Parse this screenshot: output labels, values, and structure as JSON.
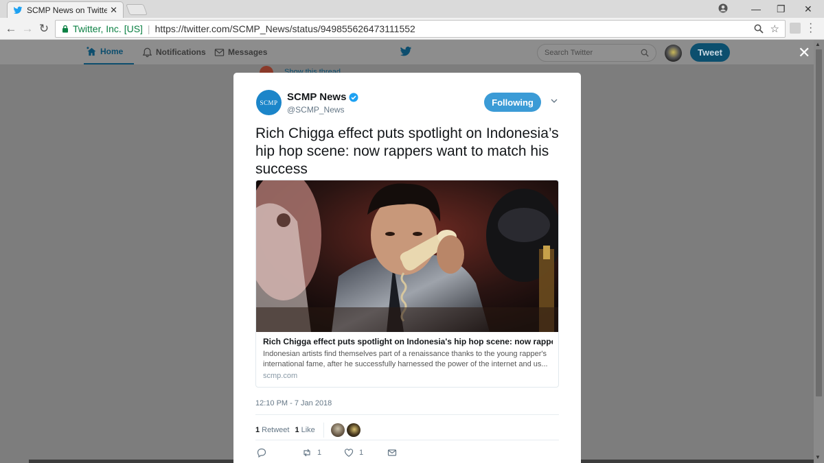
{
  "browser": {
    "tab_title": "SCMP News on Twitter: \"",
    "tab_close": "✕",
    "secure_label": "Twitter, Inc. [US]",
    "url": "https://twitter.com/SCMP_News/status/949855626473111552"
  },
  "twitter_header": {
    "nav": [
      {
        "label": "Home",
        "icon": "home-icon",
        "active": true
      },
      {
        "label": "Notifications",
        "icon": "bell-icon",
        "active": false
      },
      {
        "label": "Messages",
        "icon": "envelope-icon",
        "active": false
      }
    ],
    "search_placeholder": "Search Twitter",
    "tweet_button": "Tweet",
    "background_text": "Show this thread"
  },
  "tweet": {
    "author_name": "SCMP News",
    "author_handle": "@SCMP_News",
    "avatar_text": "SCMP",
    "follow_label": "Following",
    "text": "Rich Chigga effect puts spotlight on Indonesia’s hip hop scene: now rappers want to match his success",
    "card": {
      "title": "Rich Chigga effect puts spotlight on Indonesia's hip hop scene: now rappers ...",
      "description": "Indonesian artists find themselves part of a renaissance thanks to the young rapper's international fame, after he successfully harnessed the power of the internet and us...",
      "domain": "scmp.com"
    },
    "timestamp": "12:10 PM - 7 Jan 2018",
    "stats": {
      "retweets_count": "1",
      "retweets_label": "Retweet",
      "likes_count": "1",
      "likes_label": "Like"
    },
    "actions": {
      "reply_count": "",
      "retweet_count": "1",
      "like_count": "1"
    }
  },
  "colors": {
    "twitter_blue": "#1da1f2",
    "secure_green": "#0b8043",
    "overlay": "#7d7d7d"
  }
}
